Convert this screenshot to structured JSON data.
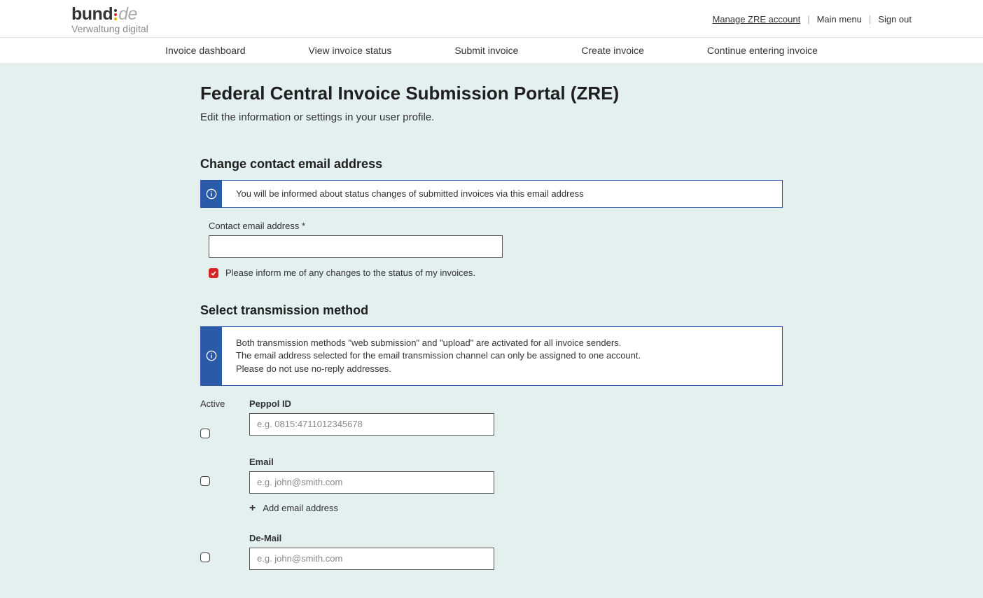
{
  "header": {
    "logo_bund": "bund",
    "logo_de": "de",
    "logo_sub": "Verwaltung digital",
    "top_links": {
      "manage": "Manage ZRE account",
      "main_menu": "Main menu",
      "sign_out": "Sign out"
    }
  },
  "nav": {
    "dashboard": "Invoice dashboard",
    "view_status": "View invoice status",
    "submit": "Submit invoice",
    "create": "Create invoice",
    "continue": "Continue entering invoice"
  },
  "page": {
    "title": "Federal Central Invoice Submission Portal (ZRE)",
    "subtitle": "Edit the information or settings in your user profile."
  },
  "section_email": {
    "heading": "Change contact email address",
    "info": "You will be informed about status changes of submitted invoices via this email address",
    "field_label": "Contact email address *",
    "field_value": "",
    "checkbox_label": "Please inform me of any changes to the status of my invoices."
  },
  "section_transmission": {
    "heading": "Select transmission method",
    "info_line1": "Both transmission methods \"web submission\" and \"upload\" are activated for all invoice senders.",
    "info_line2": "The email address selected for the email transmission channel can only be assigned to one account.",
    "info_line3": "Please do not use no-reply addresses.",
    "active_label": "Active",
    "rows": {
      "peppol": {
        "label": "Peppol ID",
        "placeholder": "e.g. 0815:4711012345678"
      },
      "email": {
        "label": "Email",
        "placeholder": "e.g. john@smith.com",
        "add_label": "Add email address"
      },
      "demail": {
        "label": "De-Mail",
        "placeholder": "e.g. john@smith.com"
      }
    }
  }
}
